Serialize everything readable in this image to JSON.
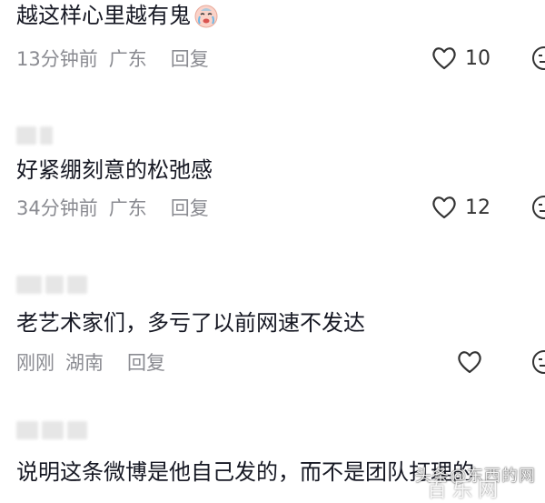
{
  "comments": [
    {
      "text": "越这样心里越有鬼",
      "emoji": "crying-face-emoji",
      "time": "13分钟前",
      "location": "广东",
      "reply_label": "回复",
      "likes": "10"
    },
    {
      "text": "好紧绷刻意的松弛感",
      "time": "34分钟前",
      "location": "广东",
      "reply_label": "回复",
      "likes": "12"
    },
    {
      "text": "老艺术家们，多亏了以前网速不发达",
      "time": "刚刚",
      "location": "湖南",
      "reply_label": "回复",
      "likes": ""
    },
    {
      "text": "说明这条微博是他自己发的，而不是团队打理的",
      "time": "",
      "location": "",
      "reply_label": "",
      "likes": ""
    }
  ],
  "watermark": {
    "text": "头条@东西的网",
    "sub": "百乐网"
  },
  "colors": {
    "text": "#161823",
    "meta": "#8a8b91",
    "blur": "#e6e6e6"
  }
}
